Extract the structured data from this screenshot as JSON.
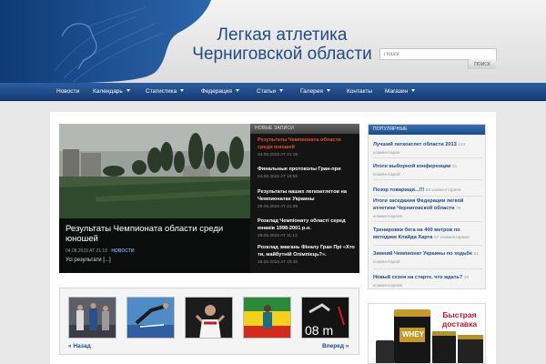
{
  "header": {
    "title_line1": "Легкая атлетика",
    "title_line2": "Черниговской области",
    "search": {
      "placeholder": "Поиск",
      "button_label": "ПОИСК"
    }
  },
  "nav": {
    "items": [
      {
        "label": "Новости",
        "has_dropdown": false
      },
      {
        "label": "Календарь",
        "has_dropdown": true
      },
      {
        "label": "Статистика",
        "has_dropdown": true
      },
      {
        "label": "Федерация",
        "has_dropdown": true
      },
      {
        "label": "Статьи",
        "has_dropdown": true
      },
      {
        "label": "Галерея",
        "has_dropdown": true
      },
      {
        "label": "Контакты",
        "has_dropdown": false
      },
      {
        "label": "Магазин",
        "has_dropdown": true
      }
    ]
  },
  "featured": {
    "title": "Результаты Чемпионата области среди юношей",
    "date": "04.08.2015 AT 21:19",
    "separator": "·",
    "category": "НОВОСТИ",
    "excerpt": "Усі результати [...]"
  },
  "recent": {
    "header": "НОВЫЕ ЗАПИСИ",
    "items": [
      {
        "title": "Результаты Чемпионата области среди юношей",
        "date": "04.08.2015 AT 21:19",
        "active": true
      },
      {
        "title": "Финальные протоколы Гран-при",
        "date": "04.08.2015 AT 16:55",
        "active": false
      },
      {
        "title": "Результаты наших легкоатлетов на Чемпионатах Украины",
        "date": "29.05.2015 AT 21:39",
        "active": false
      },
      {
        "title": "Розклад Чемпіонату області серед юнаків 1998-2001 р.н.",
        "date": "28.05.2015 AT 11:12",
        "active": false
      },
      {
        "title": "Розклад змагань Фіналу Гран Прі «Хто ти, майбутній Олімпієць?».",
        "date": "28.05.2015 AT 10:45",
        "active": false
      }
    ]
  },
  "gallery": {
    "prev_label": "« Назад",
    "next_label": "Вперед »",
    "thumb_text": "08 m"
  },
  "popular": {
    "header": "ПОПУЛЯРНЫЕ",
    "items": [
      {
        "title": "Лучший легкоатлет области 2013",
        "count": "124 комментария"
      },
      {
        "title": "Итоги выборной конференции",
        "count": "81 комментарий"
      },
      {
        "title": "Позор товарищи...!!!",
        "count": "80 комментариев"
      },
      {
        "title": "Итоги заседания Федерации легкой атлетики Черниговской области",
        "count": "79 комментариев"
      },
      {
        "title": "Тренировки бега на 400 метров по методике Клайда Харта",
        "count": "57 комментариев"
      },
      {
        "title": "Зимний Чемпионат Украины по ходьбе",
        "count": "51 комментарий"
      },
      {
        "title": "Новый сезон на старте, что ждать?",
        "count": "28 комментариев"
      }
    ]
  },
  "ad": {
    "title_line1": "Быстрая",
    "title_line2": "доставка",
    "jar_label": "WHEY"
  },
  "colors": {
    "brand_blue": "#1f4b86",
    "nav_blue": "#1c4580",
    "accent_red": "#e8502a",
    "ad_red": "#d0102a"
  }
}
